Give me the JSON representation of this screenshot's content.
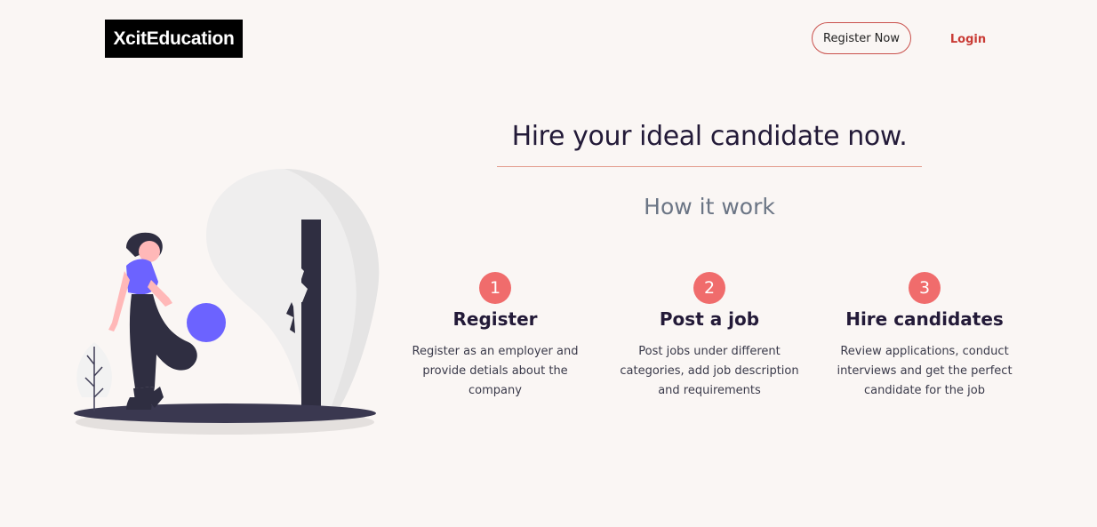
{
  "header": {
    "logo_text": "XcitEducation",
    "register_label": "Register Now",
    "login_label": "Login"
  },
  "hero": {
    "title": "Hire your ideal candidate now.",
    "subtitle": "How it work"
  },
  "steps": [
    {
      "number": "1",
      "title": "Register",
      "description": "Register as an employer and provide detials about the company"
    },
    {
      "number": "2",
      "title": "Post a job",
      "description": "Post jobs under different categories, add job description and requirements"
    },
    {
      "number": "3",
      "title": "Hire candidates",
      "description": "Review applications, conduct interviews and get the perfect candidate for the job"
    }
  ],
  "colors": {
    "accent": "#f06c6c",
    "login": "#c93b35",
    "illustration_purple": "#6c63ff",
    "dark": "#2f2e41"
  },
  "illustration": {
    "name": "woman-kicking-ball-illustration"
  }
}
